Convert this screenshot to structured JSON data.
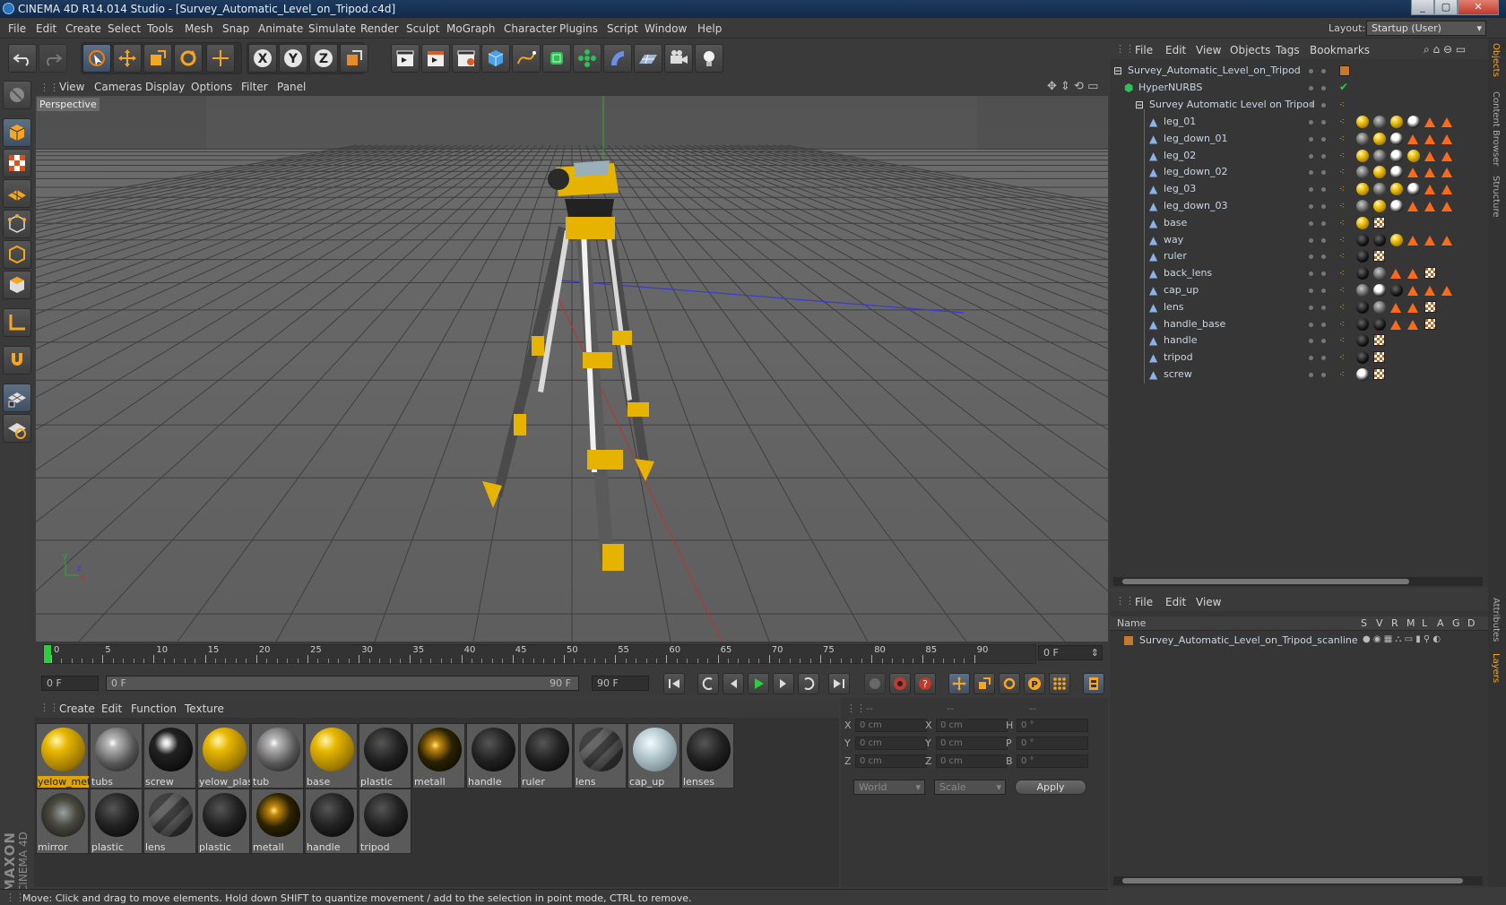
{
  "window": {
    "title": "CINEMA 4D R14.014 Studio - [Survey_Automatic_Level_on_Tripod.c4d]",
    "minimize": "_",
    "maximize": "▢",
    "close": "✕"
  },
  "menu": [
    "File",
    "Edit",
    "Create",
    "Select",
    "Tools",
    "Mesh",
    "Snap",
    "Animate",
    "Simulate",
    "Render",
    "Sculpt",
    "MoGraph",
    "Character",
    "Plugins",
    "Script",
    "Window",
    "Help"
  ],
  "layout": {
    "label": "Layout:",
    "value": "Startup (User)"
  },
  "viewport": {
    "menu": [
      "View",
      "Cameras",
      "Display",
      "Options",
      "Filter",
      "Panel"
    ],
    "label": "Perspective",
    "axis_x": "x",
    "axis_y": "y",
    "axis_z": "z"
  },
  "timeline": {
    "ticks": [
      "0",
      "5",
      "10",
      "15",
      "20",
      "25",
      "30",
      "35",
      "40",
      "45",
      "50",
      "55",
      "60",
      "65",
      "70",
      "75",
      "80",
      "85",
      "90"
    ],
    "current_frame": "0 F"
  },
  "controls": {
    "start": "0 F",
    "range_start": "0 F",
    "range_end": "90 F",
    "end": "90 F"
  },
  "materials": {
    "menu": [
      "Create",
      "Edit",
      "Function",
      "Texture"
    ],
    "items": [
      "yelow_met",
      "tubs",
      "screw",
      "yelow_plas",
      "tub",
      "base",
      "plastic",
      "metall",
      "handle",
      "ruler",
      "lens",
      "cap_up",
      "lenses",
      "mirror",
      "plastic",
      "lens",
      "plastic",
      "metall",
      "handle",
      "tripod"
    ]
  },
  "coords": {
    "headers": [
      "--",
      "--",
      "--"
    ],
    "rows": [
      {
        "a": "X",
        "av": "0 cm",
        "b": "X",
        "bv": "0 cm",
        "c": "H",
        "cv": "0 °"
      },
      {
        "a": "Y",
        "av": "0 cm",
        "b": "Y",
        "bv": "0 cm",
        "c": "P",
        "cv": "0 °"
      },
      {
        "a": "Z",
        "av": "0 cm",
        "b": "Z",
        "bv": "0 cm",
        "c": "B",
        "cv": "0 °"
      }
    ],
    "world": "World",
    "scale": "Scale",
    "apply": "Apply"
  },
  "objects": {
    "menu": [
      "File",
      "Edit",
      "View",
      "Objects",
      "Tags",
      "Bookmarks"
    ],
    "root": "Survey_Automatic_Level_on_Tripod",
    "nurbs": "HyperNURBS",
    "group": "Survey Automatic Level on Tripod",
    "children": [
      "leg_01",
      "leg_down_01",
      "leg_02",
      "leg_down_02",
      "leg_03",
      "leg_down_03",
      "base",
      "way",
      "ruler",
      "back_lens",
      "cap_up",
      "lens",
      "handle_base",
      "handle",
      "tripod",
      "screw"
    ]
  },
  "layers": {
    "menu": [
      "File",
      "Edit",
      "View"
    ],
    "col_name": "Name",
    "cols": [
      "S",
      "V",
      "R",
      "M",
      "L",
      "A",
      "G",
      "D"
    ],
    "row": "Survey_Automatic_Level_on_Tripod_scanline"
  },
  "side_tabs": [
    "Objects",
    "Content Browser",
    "Structure",
    "Attributes",
    "Layers"
  ],
  "brand": {
    "maxon": "MAXON",
    "c4d": "CINEMA 4D"
  },
  "status": "Move: Click and drag to move elements. Hold down SHIFT to quantize movement / add to the selection in point mode, CTRL to remove.",
  "colors": {
    "accent": "#e0a500",
    "select": "#f5a623",
    "bg": "#3b3b3b"
  }
}
